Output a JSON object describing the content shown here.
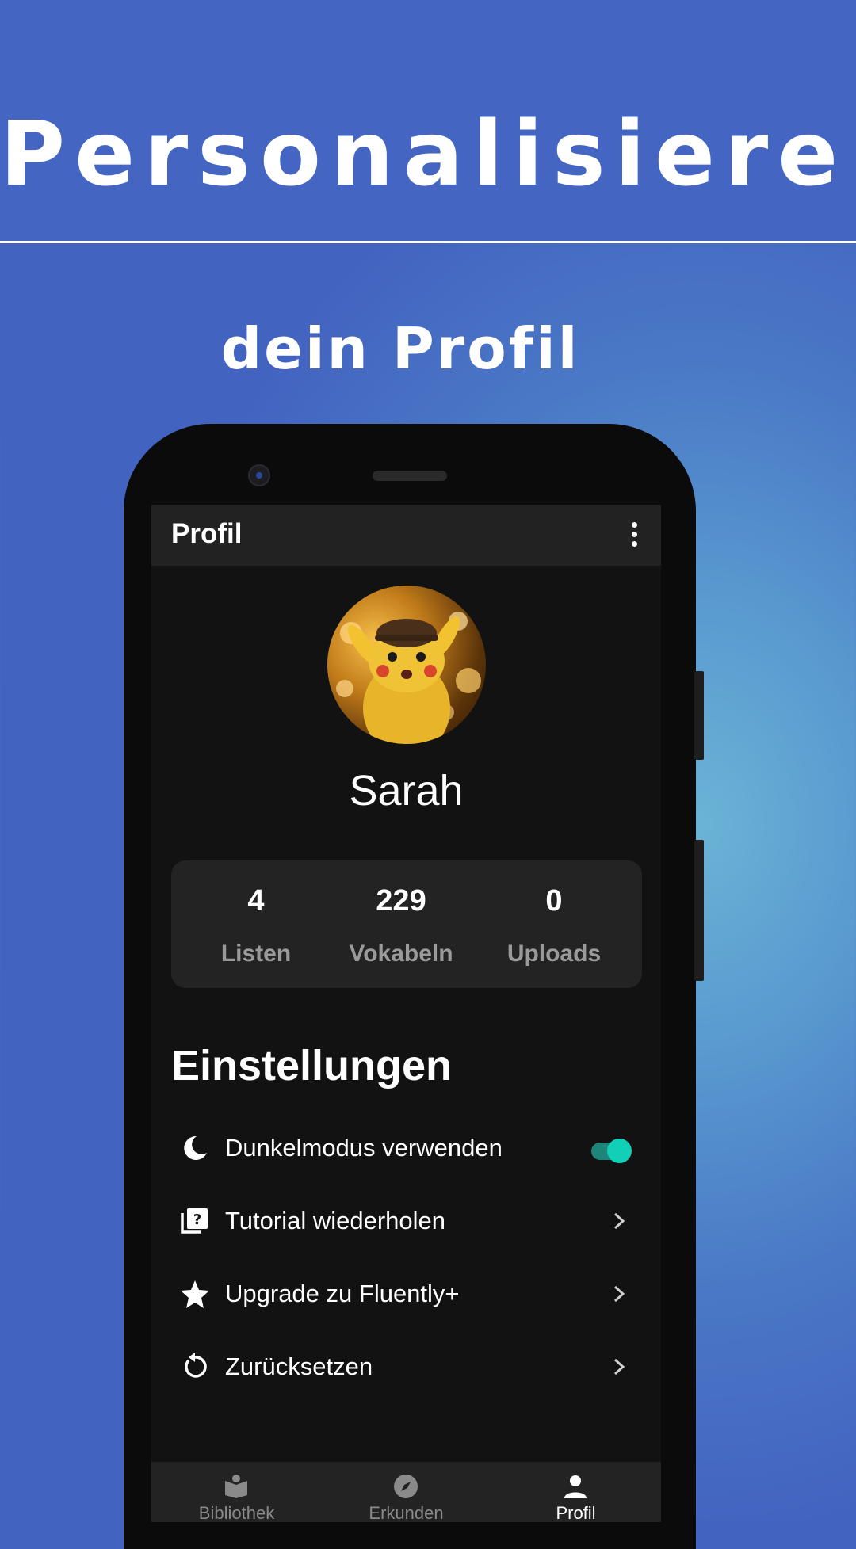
{
  "promo": {
    "headline": "Personalisiere",
    "subline": "dein Profil"
  },
  "app": {
    "title": "Profil",
    "profile": {
      "name": "Sarah",
      "avatar_icon": "pikachu-avatar-image"
    },
    "stats": [
      {
        "value": "4",
        "label": "Listen"
      },
      {
        "value": "229",
        "label": "Vokabeln"
      },
      {
        "value": "0",
        "label": "Uploads"
      }
    ],
    "settings": {
      "title": "Einstellungen",
      "items": [
        {
          "icon": "moon-icon",
          "label": "Dunkelmodus verwenden",
          "control": "toggle",
          "checked": true
        },
        {
          "icon": "quiz-icon",
          "label": "Tutorial wiederholen",
          "control": "chevron"
        },
        {
          "icon": "star-icon",
          "label": "Upgrade zu Fluently+",
          "control": "chevron"
        },
        {
          "icon": "reset-icon",
          "label": "Zurücksetzen",
          "control": "chevron"
        }
      ]
    },
    "nav": [
      {
        "icon": "book-icon",
        "label": "Bibliothek",
        "active": false
      },
      {
        "icon": "compass-icon",
        "label": "Erkunden",
        "active": false
      },
      {
        "icon": "person-icon",
        "label": "Profil",
        "active": true
      }
    ],
    "colors": {
      "accent": "#11d0b7",
      "background": "#121212",
      "surface": "#232323",
      "promo_blue": "#4466c2"
    }
  }
}
